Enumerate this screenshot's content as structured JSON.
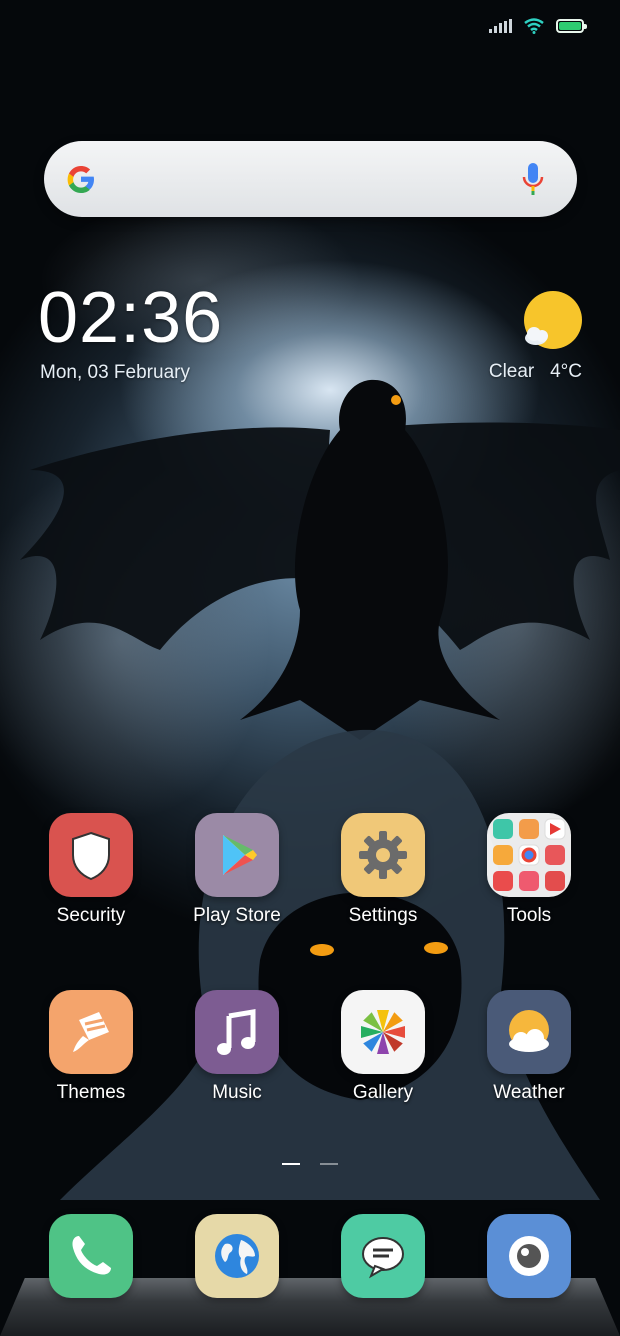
{
  "status_bar": {
    "signal_icon": "signal-icon",
    "wifi_icon": "wifi-icon",
    "battery_icon": "battery-icon",
    "battery_level": 1.0
  },
  "search": {
    "logo_icon": "google-g-icon",
    "voice_icon": "microphone-icon"
  },
  "clock": {
    "time": "02:36",
    "date": "Mon, 03 February"
  },
  "weather": {
    "condition": "Clear",
    "temperature": "4°C",
    "icon": "sun-cloud-icon"
  },
  "apps": [
    {
      "label": "Security",
      "icon": "shield-icon",
      "color": "#d9534f"
    },
    {
      "label": "Play Store",
      "icon": "play-store-icon",
      "color": "#9b8aa6"
    },
    {
      "label": "Settings",
      "icon": "gear-icon",
      "color": "#f0c878"
    },
    {
      "label": "Tools",
      "icon": "folder-icon",
      "color": "#ffffff"
    },
    {
      "label": "Themes",
      "icon": "brush-icon",
      "color": "#f4a46c"
    },
    {
      "label": "Music",
      "icon": "music-note-icon",
      "color": "#7d5c92"
    },
    {
      "label": "Gallery",
      "icon": "pinwheel-icon",
      "color": "#f5f5f5"
    },
    {
      "label": "Weather",
      "icon": "sun-cloud-icon",
      "color": "#4a5a78"
    }
  ],
  "dock": [
    {
      "icon": "phone-icon",
      "color": "#4fc386"
    },
    {
      "icon": "globe-icon",
      "color": "#e6d9a8"
    },
    {
      "icon": "chat-bubble-icon",
      "color": "#4ecba3"
    },
    {
      "icon": "camera-icon",
      "color": "#5b8fd6"
    }
  ],
  "pager": {
    "pages": 2,
    "current": 1
  }
}
